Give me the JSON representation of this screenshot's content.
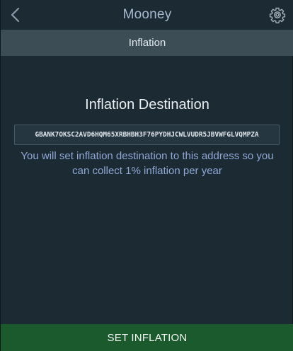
{
  "header": {
    "title": "Mooney",
    "back_icon": "chevron-left-icon",
    "settings_icon": "gear-icon"
  },
  "section": {
    "title": "Inflation"
  },
  "main": {
    "heading": "Inflation Destination",
    "address_value": "GBANK7OKSC2AVD6HQM65XRBHBH3F76PYDHJCWLVUDR5JBVWFGLVQMPZA",
    "info_text": "You will set inflation destination to this address so you can collect 1% inflation per year"
  },
  "footer": {
    "button_label": "SET INFLATION"
  },
  "colors": {
    "background": "#1c2a33",
    "section_bar": "#3d4d56",
    "accent_text": "#8fa8d6",
    "action_button": "#1a5a2c"
  }
}
